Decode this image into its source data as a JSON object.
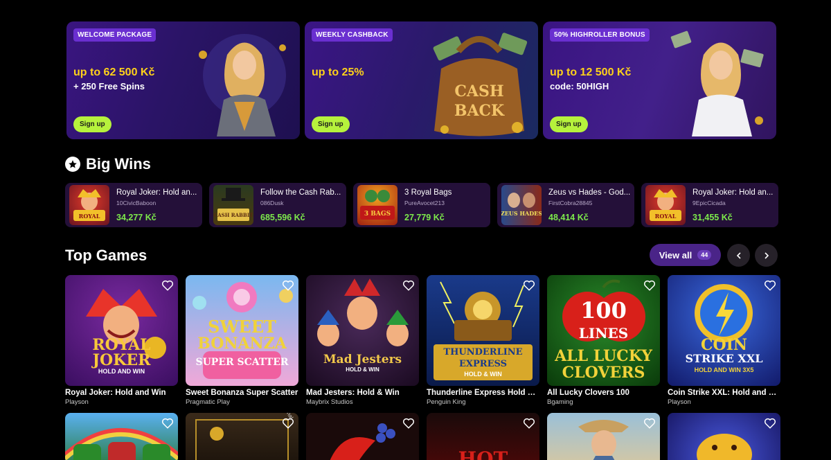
{
  "promos": [
    {
      "badge": "WELCOME PACKAGE",
      "headline": "up to 62 500 Kč",
      "sub": "+ 250 Free Spins",
      "cta": "Sign up"
    },
    {
      "badge": "WEEKLY CASHBACK",
      "headline": "up to 25%",
      "sub": "",
      "cta": "Sign up",
      "art_text": [
        "CASH",
        "BACK"
      ]
    },
    {
      "badge": "50% HIGHROLLER BONUS",
      "headline": "up to 12 500 Kč",
      "sub": "code: 50HIGH",
      "cta": "Sign up"
    }
  ],
  "big_wins": {
    "title": "Big Wins",
    "items": [
      {
        "game": "Royal Joker: Hold an...",
        "user": "10CivicBaboon",
        "amount": "34,277 Kč",
        "thumb_text": "ROYAL JOKER"
      },
      {
        "game": "Follow the Cash Rab...",
        "user": "086Dusk",
        "amount": "685,596 Kč",
        "thumb_text": "FOLLOW THE CASH RABBIT"
      },
      {
        "game": "3 Royal Bags",
        "user": "PureAvocet213",
        "amount": "27,779 Kč",
        "thumb_text": "3 ROYAL BAGS"
      },
      {
        "game": "Zeus vs Hades - God...",
        "user": "FirstCobra28845",
        "amount": "48,414 Kč",
        "thumb_text": "ZEUS HADES"
      },
      {
        "game": "Royal Joker: Hold an...",
        "user": "9EpicCicada",
        "amount": "31,455 Kč",
        "thumb_text": "ROYAL JOKER"
      }
    ]
  },
  "top_games": {
    "title": "Top Games",
    "view_all": "View all",
    "count": "44",
    "items": [
      {
        "title": "Royal Joker: Hold and Win",
        "provider": "Playson",
        "art": [
          "ROYAL",
          "JOKER",
          "HOLD AND WIN"
        ]
      },
      {
        "title": "Sweet Bonanza Super Scatter",
        "provider": "Pragmatic Play",
        "art": [
          "SWEET",
          "BONANZA",
          "SUPER SCATTER"
        ]
      },
      {
        "title": "Mad Jesters: Hold & Win",
        "provider": "Maybrix Studios",
        "art": [
          "Mad Jesters",
          "HOLD & WIN"
        ]
      },
      {
        "title": "Thunderline Express Hold & ...",
        "provider": "Penguin King",
        "art": [
          "THUNDERLINE",
          "EXPRESS",
          "HOLD & WIN"
        ]
      },
      {
        "title": "All Lucky Clovers 100",
        "provider": "Bgaming",
        "art": [
          "100",
          "LINES",
          "ALL LUCKY",
          "CLOVERS"
        ]
      },
      {
        "title": "Coin Strike XXL: Hold and W...",
        "provider": "Playson",
        "art": [
          "COIN",
          "STRIKE XXL",
          "HOLD AND WIN 3X5"
        ]
      }
    ],
    "row2_art": [
      "",
      "Spinomenal",
      "",
      "HOT",
      "",
      ""
    ]
  },
  "colors": {
    "accent": "#4a2488",
    "cta": "#b6f23c",
    "win_amount": "#7dea4b",
    "headline": "#ffd21a"
  }
}
